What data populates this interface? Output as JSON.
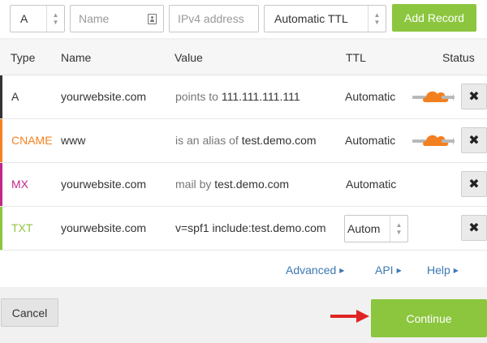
{
  "toolbar": {
    "type_value": "A",
    "name_placeholder": "Name",
    "ip_placeholder": "IPv4 address",
    "ttl_value": "Automatic TTL",
    "add_label": "Add Record"
  },
  "table": {
    "headers": {
      "type": "Type",
      "name": "Name",
      "value": "Value",
      "ttl": "TTL",
      "status": "Status"
    },
    "rows": [
      {
        "type": "A",
        "type_color": "#333333",
        "bar_color": "#333333",
        "name": "yourwebsite.com",
        "value_prefix": "points to",
        "value": "111.111.111.111",
        "ttl": "Automatic",
        "proxied": true
      },
      {
        "type": "CNAME",
        "type_color": "#f58220",
        "bar_color": "#f58220",
        "name": "www",
        "value_prefix": "is an alias of",
        "value": "test.demo.com",
        "ttl": "Automatic",
        "proxied": true
      },
      {
        "type": "MX",
        "type_color": "#c1278c",
        "bar_color": "#c1278c",
        "name": "yourwebsite.com",
        "value_prefix": "mail",
        "value_connector": "by",
        "value": "test.demo.com",
        "ttl": "Automatic",
        "proxied": false
      },
      {
        "type": "TXT",
        "type_color": "#8cc63f",
        "bar_color": "#8cc63f",
        "name": "yourwebsite.com",
        "value": "v=spf1 include:test.demo.com",
        "ttl": "Autom",
        "proxied": false
      }
    ],
    "delete_icon": "close-icon",
    "links": {
      "advanced": "Advanced",
      "api": "API",
      "help": "Help"
    }
  },
  "footer": {
    "cancel_label": "Cancel",
    "continue_label": "Continue"
  },
  "colors": {
    "accent_green": "#8cc63f",
    "cloud_orange": "#f38020",
    "link_blue": "#3c78b4",
    "arrow_red": "#e02424"
  }
}
